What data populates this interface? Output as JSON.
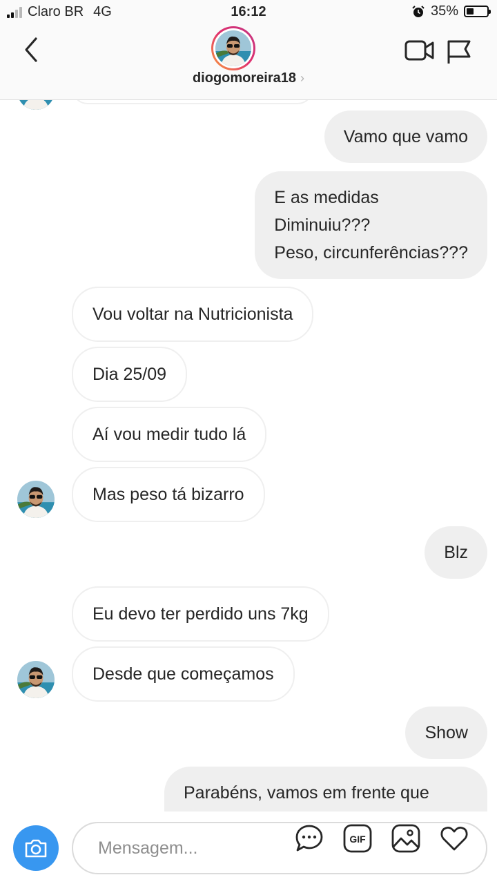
{
  "status_bar": {
    "carrier": "Claro BR",
    "network": "4G",
    "time": "16:12",
    "battery": "35%"
  },
  "header": {
    "username": "diogomoreira18",
    "chevron": "›"
  },
  "icons": {
    "back": "chevron-left-icon",
    "video": "video-call-icon",
    "flag": "flag-icon",
    "camera": "camera-icon",
    "chat": "chat-bubble-icon",
    "gif": "gif-icon",
    "image": "image-icon",
    "heart": "heart-icon"
  },
  "colors": {
    "accent": "#3897f0",
    "bubble_out": "#efefef",
    "bubble_in_border": "#efefef"
  },
  "messages": [
    {
      "from": "me",
      "lines": [
        "Vamo que vamo"
      ]
    },
    {
      "from": "me",
      "lines": [
        "E as medidas",
        "Diminuiu???",
        "Peso, circunferências???"
      ]
    },
    {
      "from": "them",
      "lines": [
        "Vou voltar na Nutricionista"
      ]
    },
    {
      "from": "them",
      "lines": [
        "Dia 25/09"
      ]
    },
    {
      "from": "them",
      "lines": [
        "Aí vou medir tudo lá"
      ]
    },
    {
      "from": "them",
      "lines": [
        "Mas peso tá bizarro"
      ]
    },
    {
      "from": "me",
      "lines": [
        "Blz"
      ]
    },
    {
      "from": "them",
      "lines": [
        "Eu devo ter perdido uns 7kg"
      ]
    },
    {
      "from": "them",
      "lines": [
        "Desde que começamos"
      ]
    },
    {
      "from": "me",
      "lines": [
        "Show"
      ]
    },
    {
      "from": "me",
      "lines": [
        "Parabéns, vamos em frente que"
      ]
    }
  ],
  "composer": {
    "placeholder": "Mensagem...",
    "gif_label": "GIF"
  }
}
